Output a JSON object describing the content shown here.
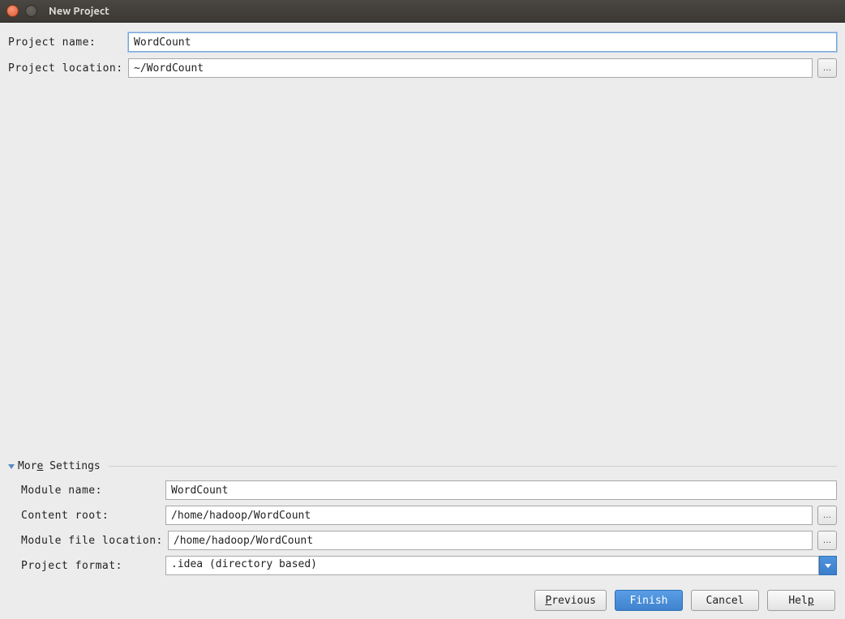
{
  "window": {
    "title": "New Project"
  },
  "form": {
    "project_name_label": "Project name:",
    "project_name_value": "WordCount",
    "project_location_label": "Project location:",
    "project_location_value": "~/WordCount",
    "browse_label": "…"
  },
  "more_settings": {
    "header_prefix": "Mor",
    "header_underline": "e",
    "header_suffix": " Settings",
    "module_name_label": "Module name:",
    "module_name_value": "WordCount",
    "content_root_label": "Content root:",
    "content_root_value": "/home/hadoop/WordCount",
    "module_file_location_label": "Module file location:",
    "module_file_location_value": "/home/hadoop/WordCount",
    "project_format_label": "Project format:",
    "project_format_value": ".idea (directory based)"
  },
  "footer": {
    "previous": "Previous",
    "finish": "Finish",
    "cancel": "Cancel",
    "help_prefix": "Hel",
    "help_underline": "p"
  }
}
